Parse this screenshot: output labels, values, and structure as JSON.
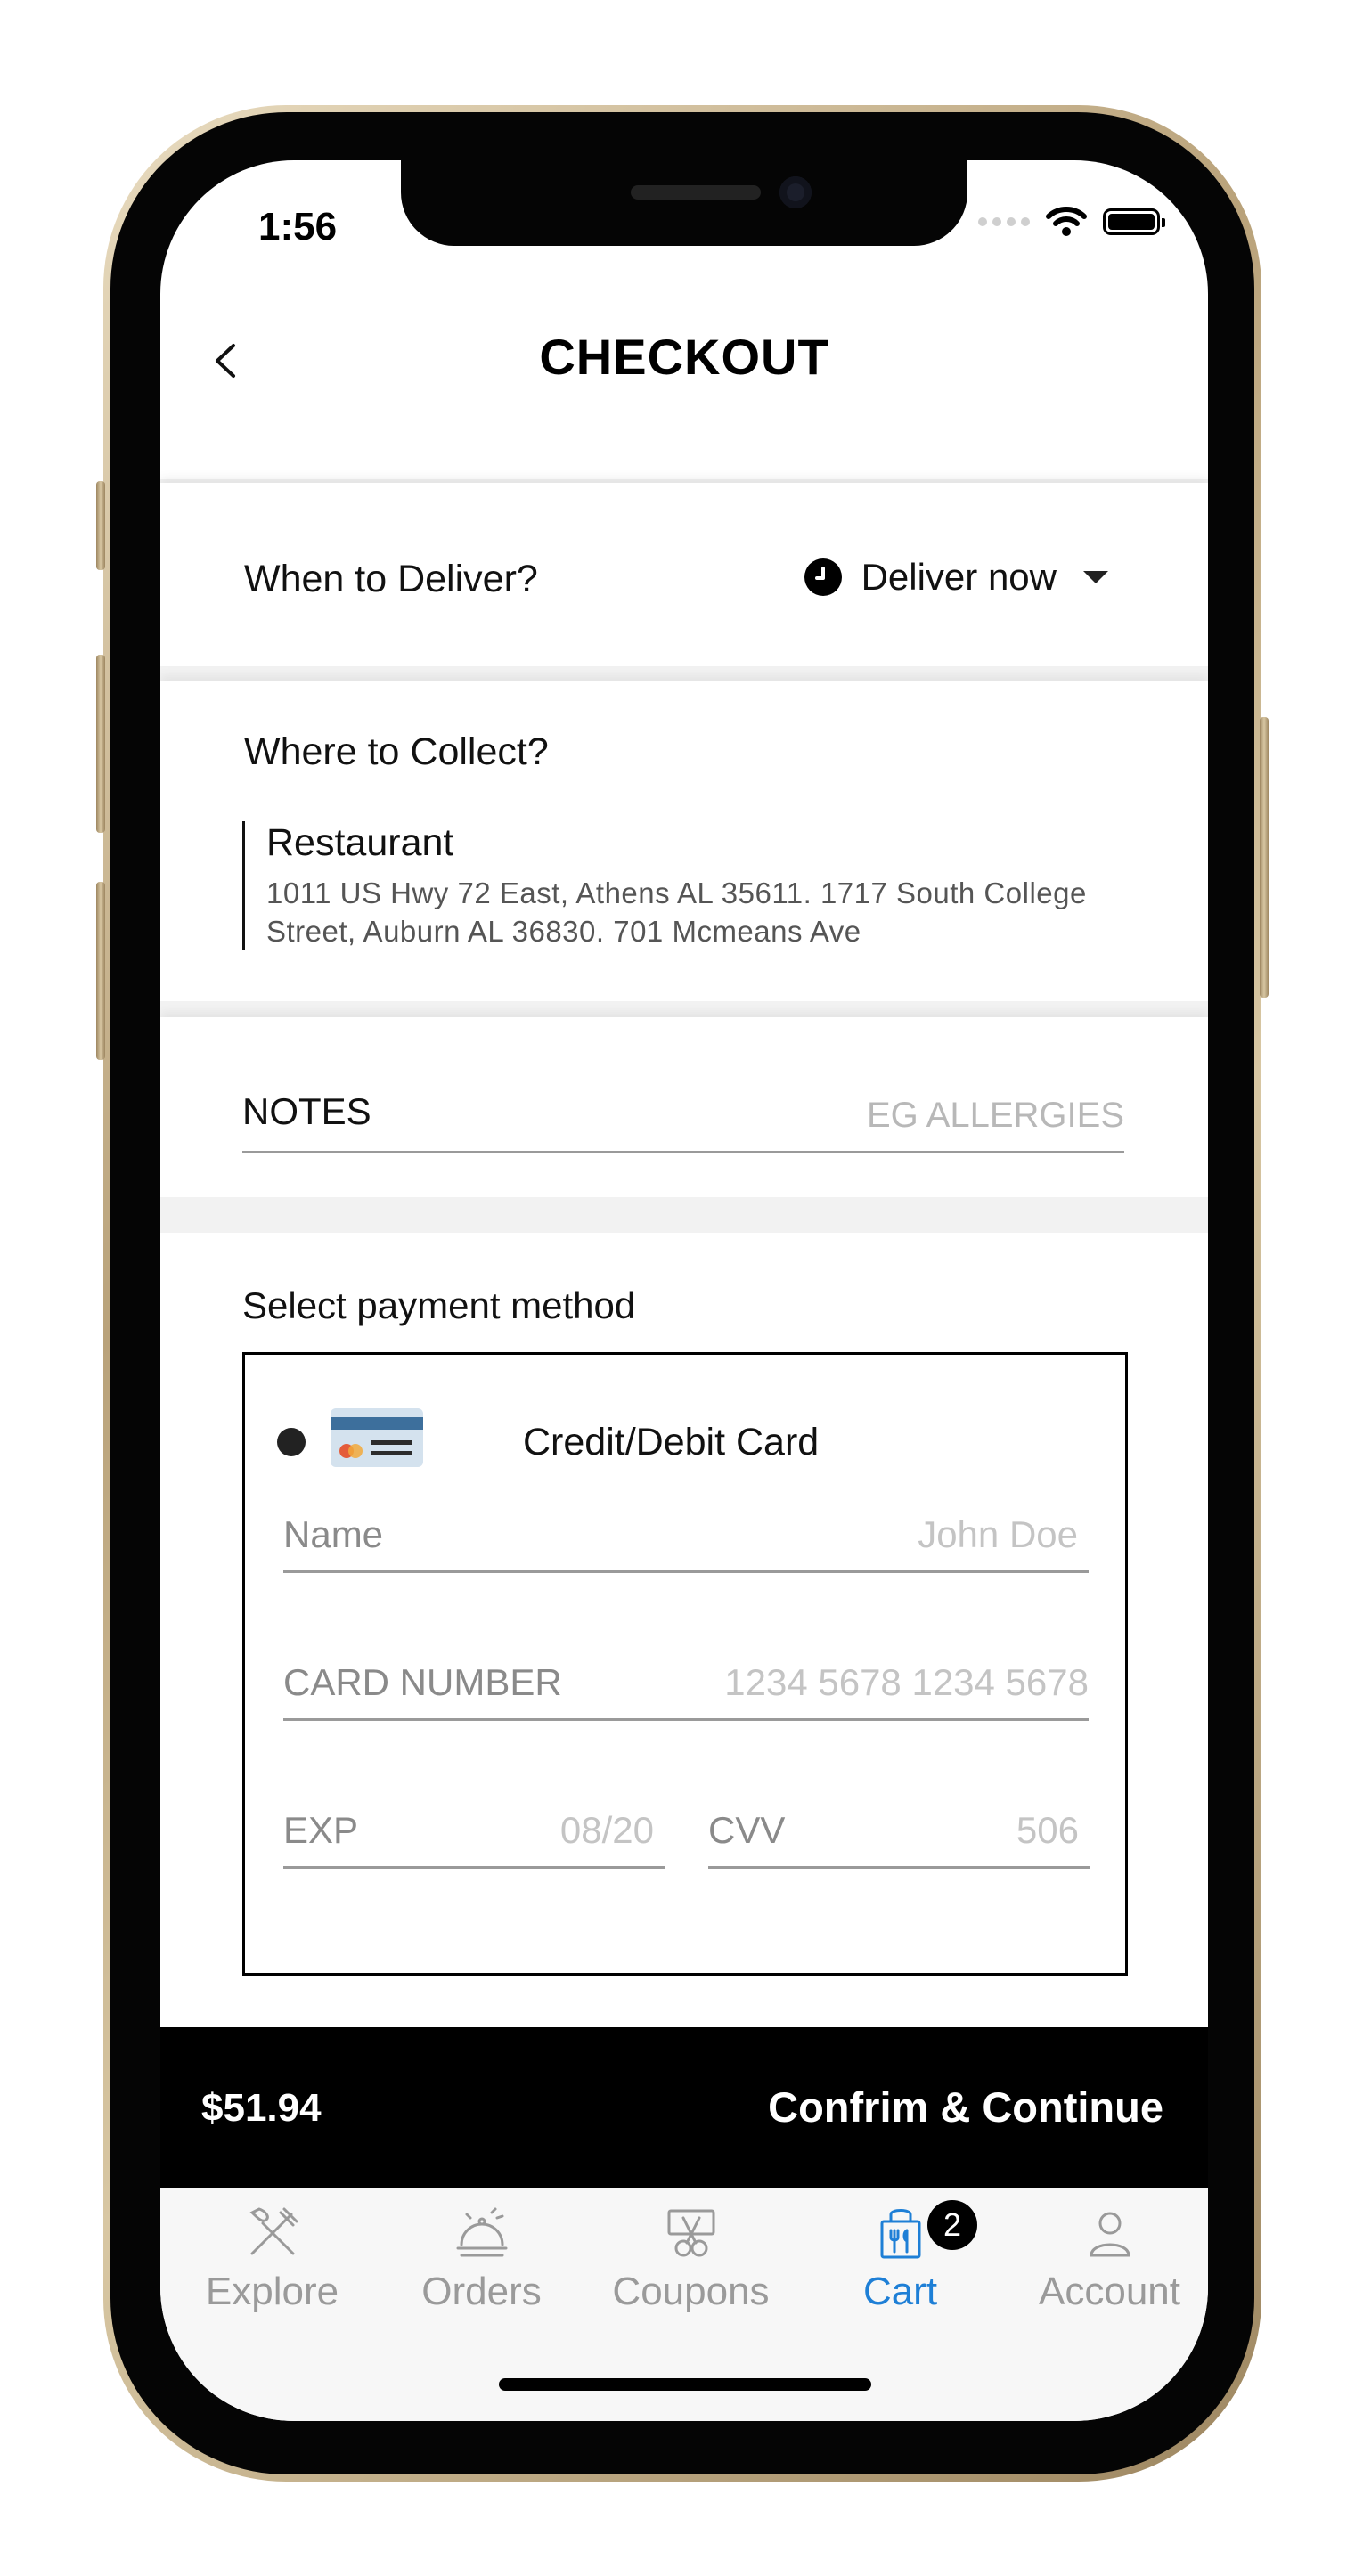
{
  "status_bar": {
    "time": "1:56"
  },
  "header": {
    "title": "CHECKOUT"
  },
  "delivery": {
    "label": "When to Deliver?",
    "value": "Deliver now"
  },
  "collect": {
    "label": "Where to Collect?",
    "name": "Restaurant",
    "address": "1011 US Hwy 72 East, Athens AL 35611. 1717 South College Street, Auburn AL 36830. 701 Mcmeans Ave"
  },
  "notes": {
    "label": "NOTES",
    "placeholder": "EG ALLERGIES"
  },
  "payment": {
    "title": "Select payment method",
    "method_label": "Credit/Debit Card",
    "name_label": "Name",
    "name_placeholder": "John Doe",
    "card_label": "CARD NUMBER",
    "card_placeholder": "1234 5678 1234 5678",
    "exp_label": "EXP",
    "exp_placeholder": "08/20",
    "cvv_label": "CVV",
    "cvv_placeholder": "506"
  },
  "checkout": {
    "total": "$51.94",
    "confirm_label": "Confrim & Continue"
  },
  "tabs": [
    {
      "label": "Explore",
      "icon": "fork-knife-icon"
    },
    {
      "label": "Orders",
      "icon": "cloche-icon"
    },
    {
      "label": "Coupons",
      "icon": "coupon-scissors-icon"
    },
    {
      "label": "Cart",
      "icon": "cart-bag-icon",
      "badge": "2",
      "active": true
    },
    {
      "label": "Account",
      "icon": "person-icon"
    }
  ],
  "colors": {
    "accent": "#1e7fd6",
    "inactive": "#9a9a9a"
  }
}
